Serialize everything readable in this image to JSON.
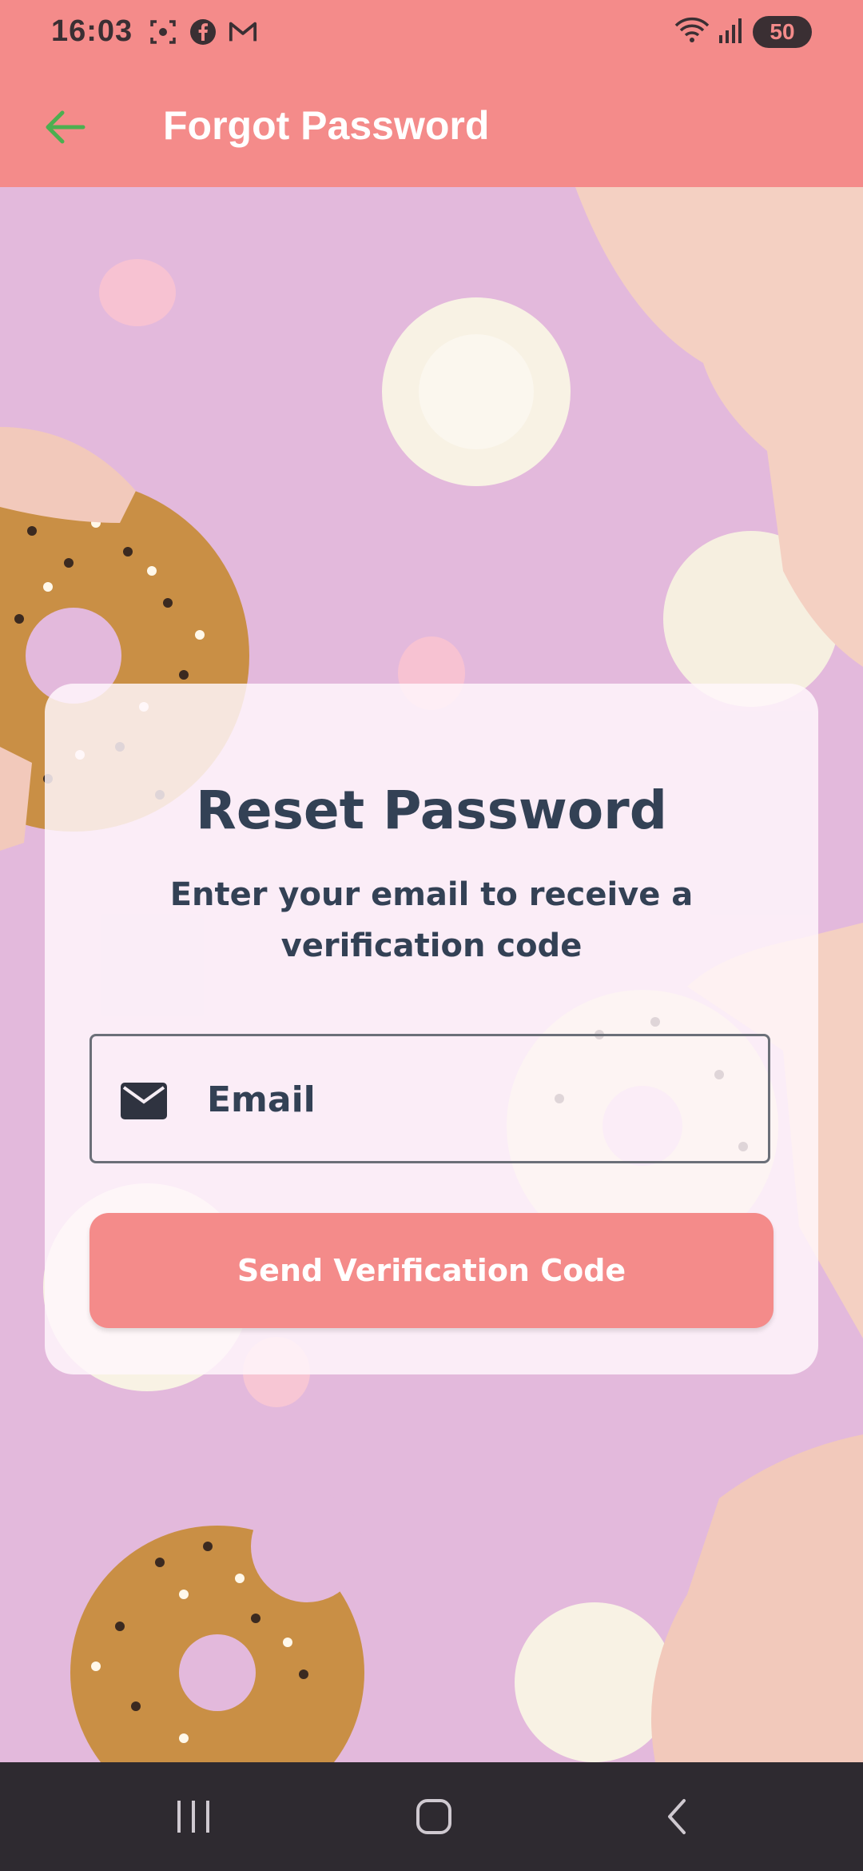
{
  "status_bar": {
    "time": "16:03",
    "left_icons": [
      "screenshot-icon",
      "facebook-icon",
      "gmail-icon"
    ],
    "right_icons": [
      "wifi-icon",
      "signal-icon"
    ],
    "battery": "50"
  },
  "app_bar": {
    "title": "Forgot Password",
    "back_icon": "arrow-left-icon",
    "back_icon_color": "#4caf50"
  },
  "card": {
    "title": "Reset Password",
    "subtitle": "Enter your email to receive a verification code",
    "email": {
      "placeholder": "Email",
      "value": "",
      "icon": "mail-icon"
    },
    "send_button_label": "Send Verification Code"
  },
  "navigation": {
    "items": [
      "recent-apps-icon",
      "home-icon",
      "back-icon"
    ]
  },
  "colors": {
    "accent": "#f48b8a",
    "background": "#e3b9dc",
    "text_dark": "#334155"
  }
}
